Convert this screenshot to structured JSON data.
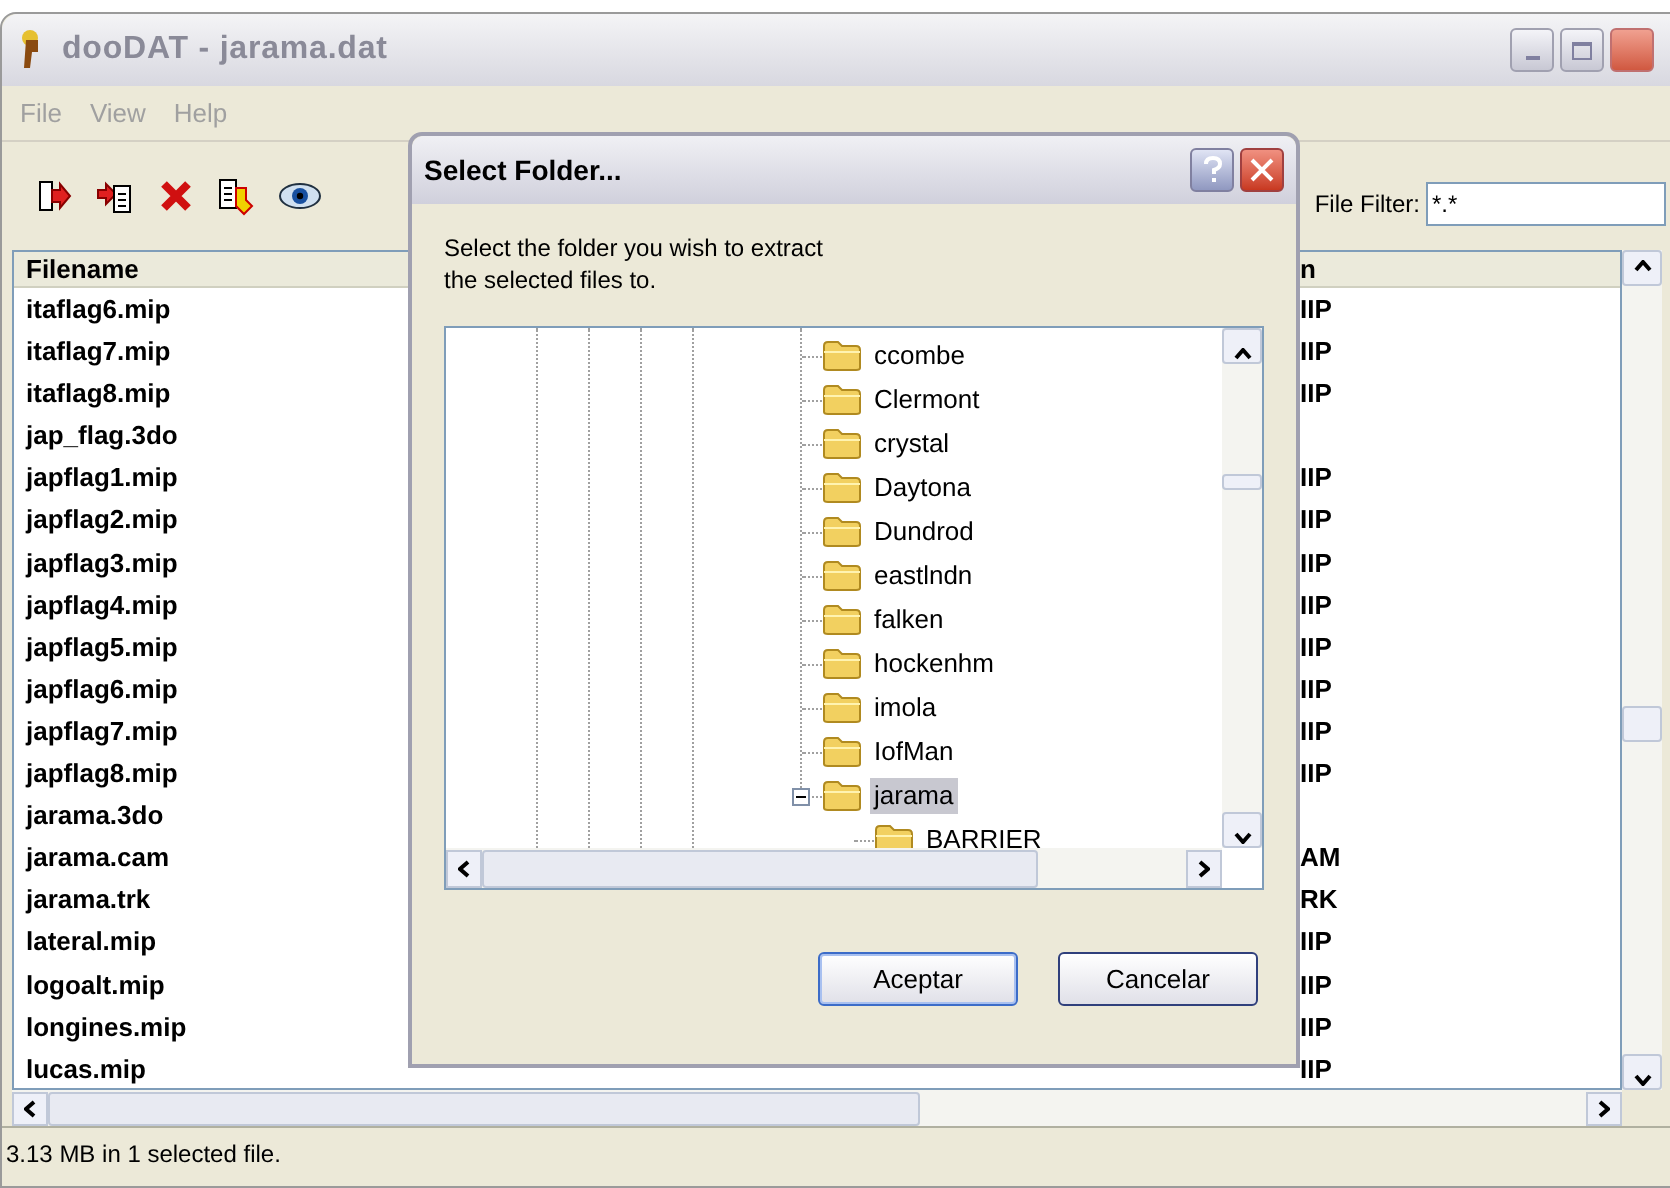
{
  "window": {
    "title": "dooDAT - jarama.dat"
  },
  "menu": [
    "File",
    "View",
    "Help"
  ],
  "toolbar": {
    "filter_label": "File Filter:",
    "filter_value": "*.*"
  },
  "list": {
    "columns": [
      "Filename",
      "n"
    ],
    "rows": [
      {
        "filename": "itaflag6.mip",
        "column_2": "IIP"
      },
      {
        "filename": "itaflag7.mip",
        "column_2": "IIP"
      },
      {
        "filename": "itaflag8.mip",
        "column_2": "IIP"
      },
      {
        "filename": "jap_flag.3do"
      },
      {
        "filename": "japflag1.mip",
        "column_2": "IIP"
      },
      {
        "filename": "japflag2.mip",
        "column_2": "IIP"
      },
      {
        "filename": "japflag3.mip",
        "column_2": "IIP"
      },
      {
        "filename": "japflag4.mip",
        "column_2": "IIP"
      },
      {
        "filename": "japflag5.mip",
        "column_2": "IIP"
      },
      {
        "filename": "japflag6.mip",
        "column_2": "IIP"
      },
      {
        "filename": "japflag7.mip",
        "column_2": "IIP"
      },
      {
        "filename": "japflag8.mip",
        "column_2": "IIP"
      },
      {
        "filename": "jarama.3do"
      },
      {
        "filename": "jarama.cam",
        "column_2": "AM"
      },
      {
        "filename": "jarama.trk",
        "column_2": "RK"
      },
      {
        "filename": "lateral.mip",
        "column_2": "IIP"
      },
      {
        "filename": "logoalt.mip",
        "column_2": "IIP"
      },
      {
        "filename": "longines.mip",
        "column_2": "IIP"
      },
      {
        "filename": "lucas.mip",
        "column_2": "IIP"
      }
    ]
  },
  "status_bar": "3.13 MB in 1 selected file.",
  "dialog": {
    "title": "Select Folder...",
    "prompt": "Select the folder you wish to extract the selected files to.",
    "tree": [
      {
        "label": "ccombe",
        "selected": false
      },
      {
        "label": "Clermont",
        "selected": false
      },
      {
        "label": "crystal",
        "selected": false
      },
      {
        "label": "Daytona",
        "selected": false
      },
      {
        "label": "Dundrod",
        "selected": false
      },
      {
        "label": "eastlndn",
        "selected": false
      },
      {
        "label": "falken",
        "selected": false
      },
      {
        "label": "hockenhm",
        "selected": false
      },
      {
        "label": "imola",
        "selected": false
      },
      {
        "label": "IofMan",
        "selected": false
      },
      {
        "label": "jarama",
        "selected": true,
        "expanded": true,
        "children": [
          {
            "label": "BARRIER",
            "selected": false
          }
        ]
      }
    ],
    "buttons": [
      "Aceptar",
      "Cancelar"
    ]
  }
}
